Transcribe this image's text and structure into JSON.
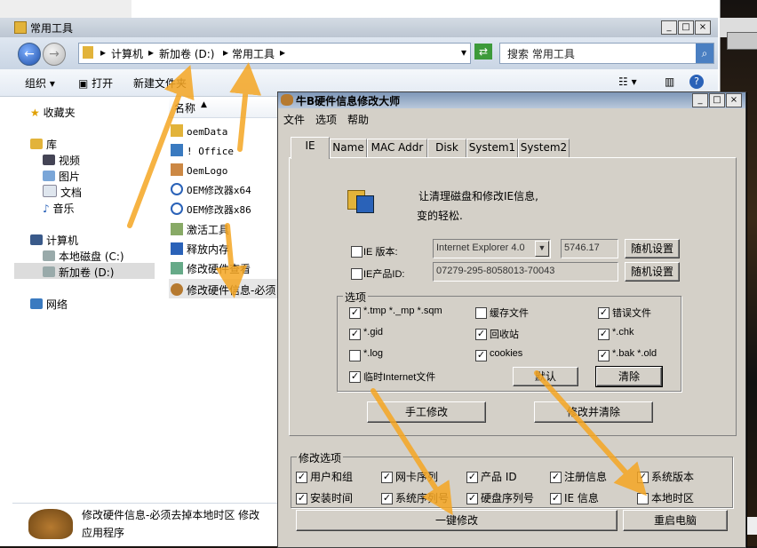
{
  "explorer": {
    "title": "常用工具",
    "breadcrumb": [
      "计算机",
      "新加卷 (D:)",
      "常用工具"
    ],
    "search_placeholder": "搜索 常用工具",
    "toolbar": {
      "organize": "组织",
      "open": "打开",
      "new_folder": "新建文件夹"
    },
    "nav": {
      "favorites": "收藏夹",
      "libraries": "库",
      "lib_items": [
        "视频",
        "图片",
        "文档",
        "音乐"
      ],
      "computer": "计算机",
      "drives": [
        "本地磁盘 (C:)",
        "新加卷 (D:)"
      ],
      "network": "网络"
    },
    "column_name": "名称",
    "files": [
      "oemData",
      "! Office",
      "OemLogo",
      "OEM修改器x64",
      "OEM修改器x86",
      "激活工具",
      "释放内存",
      "修改硬件查看",
      "修改硬件信息-必须"
    ],
    "details": {
      "name": "修改硬件信息-必须去掉本地时区 修改",
      "type": "应用程序"
    }
  },
  "dialog": {
    "title": "牛B硬件信息修改大师",
    "menu": [
      "文件",
      "选项",
      "帮助"
    ],
    "tabs": [
      "IE",
      "Name",
      "MAC Addr",
      "Disk",
      "System1",
      "System2"
    ],
    "intro_line1": "让清理磁盘和修改IE信息,",
    "intro_line2": "变的轻松.",
    "ie_version_label": "IE 版本:",
    "ie_version_value": "Internet Explorer 4.0",
    "ie_version_num": "5746.17",
    "ie_productid_label": "IE产品ID:",
    "ie_productid_value": "07279-295-8058013-70043",
    "random_btn": "随机设置",
    "options_caption": "选项",
    "options": [
      {
        "label": "*.tmp *._mp *.sqm",
        "checked": true
      },
      {
        "label": "缓存文件",
        "checked": false
      },
      {
        "label": "错误文件",
        "checked": true
      },
      {
        "label": "*.gid",
        "checked": true
      },
      {
        "label": "回收站",
        "checked": true
      },
      {
        "label": "*.chk",
        "checked": true
      },
      {
        "label": "*.log",
        "checked": false
      },
      {
        "label": "cookies",
        "checked": true
      },
      {
        "label": "*.bak *.old",
        "checked": true
      },
      {
        "label": "临时Internet文件",
        "checked": true
      }
    ],
    "default_btn": "默认",
    "clear_btn": "清除",
    "manual_btn": "手工修改",
    "modify_clear_btn": "修改并清除",
    "modify_caption": "修改选项",
    "modify_options": [
      {
        "label": "用户和组",
        "checked": true
      },
      {
        "label": "网卡序列",
        "checked": true
      },
      {
        "label": "产品 ID",
        "checked": true
      },
      {
        "label": "注册信息",
        "checked": true
      },
      {
        "label": "系统版本",
        "checked": true
      },
      {
        "label": "安装时间",
        "checked": true
      },
      {
        "label": "系统序列号",
        "checked": true
      },
      {
        "label": "硬盘序列号",
        "checked": true
      },
      {
        "label": "IE 信息",
        "checked": true
      },
      {
        "label": "本地时区",
        "checked": false
      }
    ],
    "one_click_btn": "一键修改",
    "reboot_btn": "重启电脑"
  },
  "colors": {
    "arrow": "#f5a623",
    "title_bar": "#b9c8db",
    "dialog_bg": "#d4d0c8"
  }
}
